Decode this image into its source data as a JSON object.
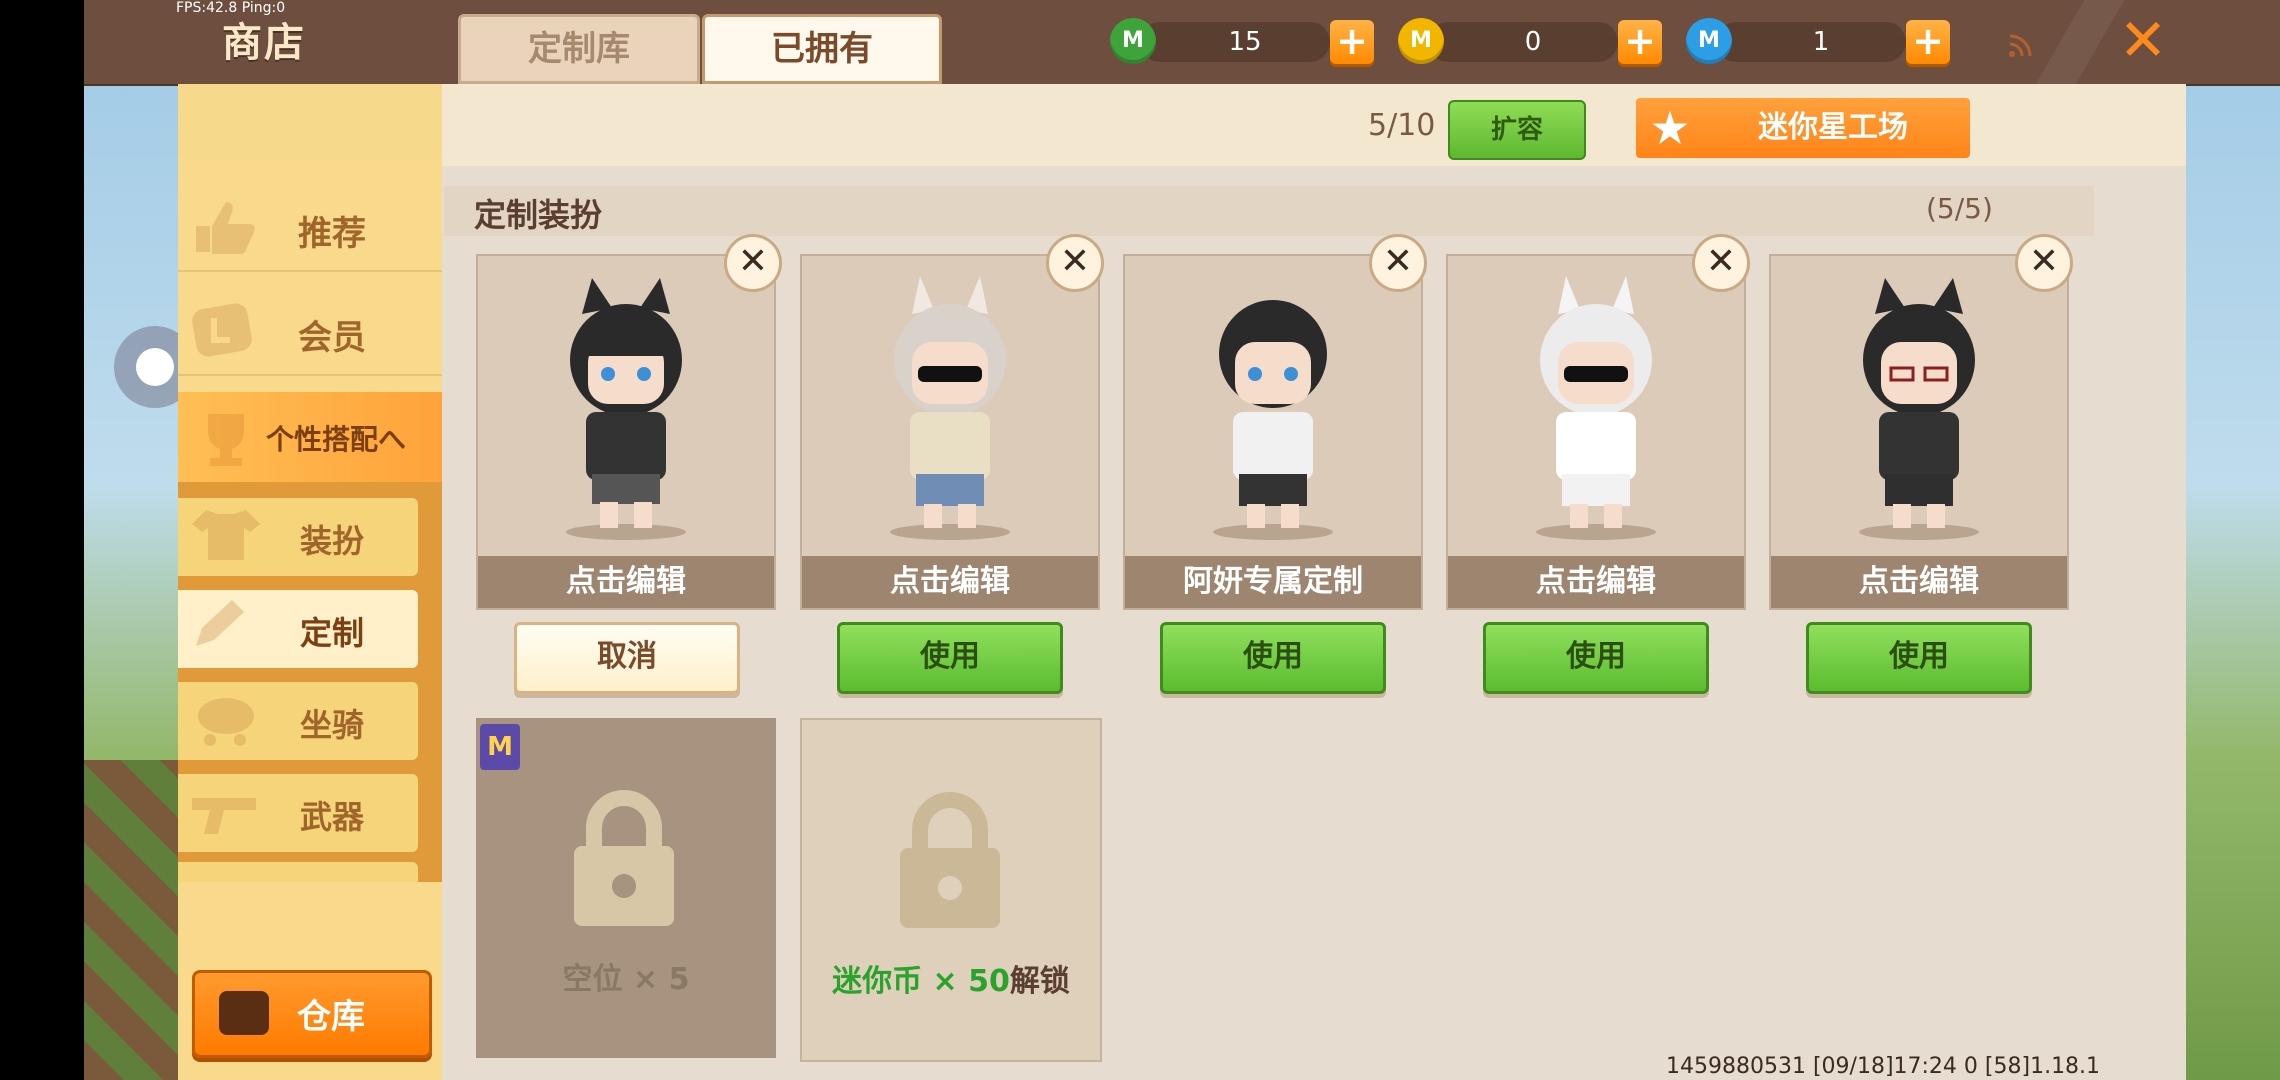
{
  "status": {
    "fps_text": "FPS:42.8  Ping:0"
  },
  "header": {
    "title": "商店"
  },
  "currencies": [
    {
      "name": "green-gem",
      "value": "15",
      "color": "#4caf50",
      "glyph": "M"
    },
    {
      "name": "gold-coin",
      "value": "0",
      "color": "#f5b800",
      "glyph": "M"
    },
    {
      "name": "blue-coin",
      "value": "1",
      "color": "#2b9ee6",
      "glyph": "M"
    }
  ],
  "sidebar": {
    "items": [
      {
        "label": "推荐"
      },
      {
        "label": "会员"
      },
      {
        "label": "个性搭配へ"
      }
    ],
    "subitems": [
      {
        "label": "装扮"
      },
      {
        "label": "定制"
      },
      {
        "label": "坐骑"
      },
      {
        "label": "武器"
      }
    ],
    "warehouse_label": "仓库"
  },
  "tabs": [
    {
      "label": "定制库"
    },
    {
      "label": "已拥有"
    }
  ],
  "toolbar": {
    "capacity": "5/10",
    "expand_label": "扩容",
    "factory_label": "迷你星工场"
  },
  "section": {
    "title": "定制装扮",
    "count": "(5/5)"
  },
  "outfits": [
    {
      "caption": "点击编辑",
      "action": "取消"
    },
    {
      "caption": "点击编辑",
      "action": "使用"
    },
    {
      "caption": "阿妍专属定制",
      "action": "使用"
    },
    {
      "caption": "点击编辑",
      "action": "使用"
    },
    {
      "caption": "点击编辑",
      "action": "使用"
    }
  ],
  "slots": {
    "empty_label": "空位",
    "empty_count": "× 5",
    "locked_currency": "迷你币 × 50",
    "locked_suffix": "解锁"
  },
  "footer": {
    "info": "1459880531   [09/18]17:24 0   [58]1.18.1"
  },
  "colors": {
    "accent": "#ff8a1c",
    "use_green": "#5cbc30",
    "nav_active": "#ffa33a"
  }
}
